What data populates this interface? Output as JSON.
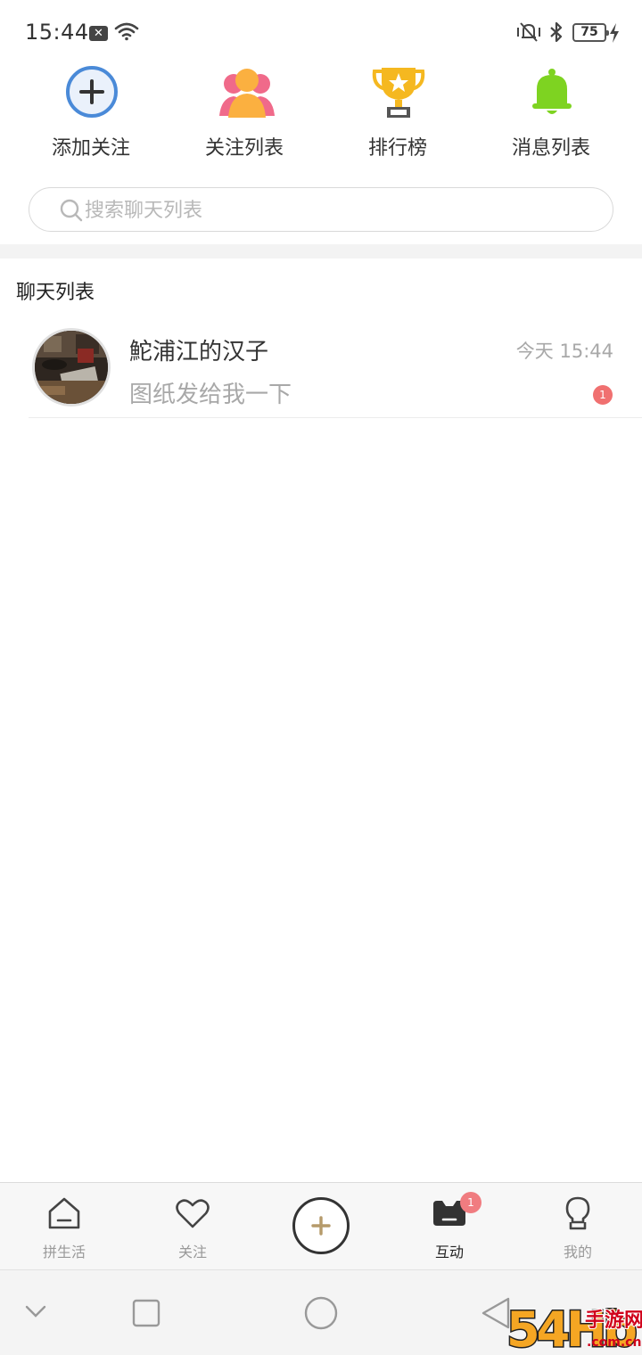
{
  "status_bar": {
    "time": "15:44",
    "notification_glyph": "✕",
    "battery": "75"
  },
  "quick_actions": [
    {
      "label": "添加关注",
      "icon": "add-circle-icon"
    },
    {
      "label": "关注列表",
      "icon": "people-icon"
    },
    {
      "label": "排行榜",
      "icon": "trophy-icon"
    },
    {
      "label": "消息列表",
      "icon": "bell-icon"
    }
  ],
  "search": {
    "placeholder": "搜索聊天列表"
  },
  "section": {
    "title": "聊天列表"
  },
  "chats": [
    {
      "name": "鮀浦江的汉子",
      "time": "今天 15:44",
      "preview": "图纸发给我一下",
      "unread": "1"
    }
  ],
  "tab_bar": {
    "tabs": [
      {
        "label": "拼生活",
        "icon": "home-icon",
        "active": false
      },
      {
        "label": "关注",
        "icon": "heart-icon",
        "active": false
      },
      {
        "label": "",
        "icon": "plus-icon",
        "active": false
      },
      {
        "label": "互动",
        "icon": "chat-icon",
        "active": true,
        "badge": "1"
      },
      {
        "label": "我的",
        "icon": "profile-icon",
        "active": false
      }
    ]
  },
  "colors": {
    "accent_blue": "#4a8ad8",
    "people_orange": "#fbb040",
    "people_pink": "#f06a8a",
    "trophy_gold": "#f5b820",
    "bell_green": "#7ed321",
    "badge_red": "#f07070",
    "plus_gold": "#b59a6a"
  },
  "watermark": {
    "brand": "54Hb",
    "title": "手游网",
    "domain": ".com.cn"
  }
}
